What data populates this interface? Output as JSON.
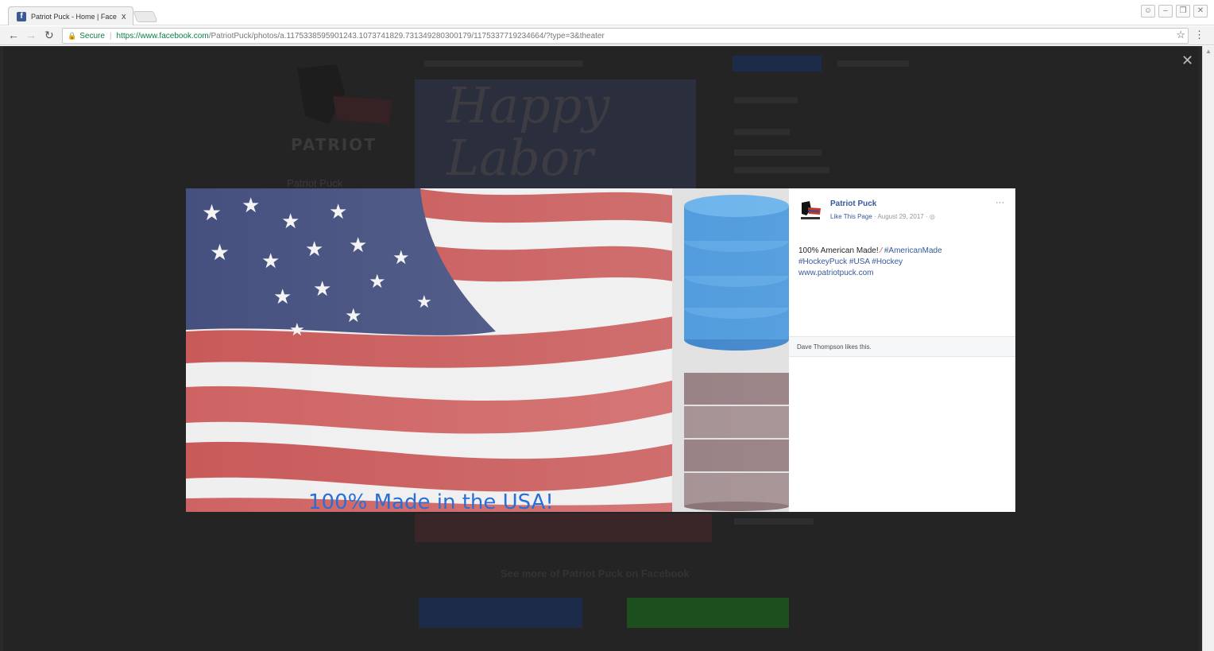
{
  "browser": {
    "tab_title": "Patriot Puck - Home | Face",
    "tab_close": "x",
    "secure_label": "Secure",
    "url_host": "https://www.facebook.com",
    "url_path": "/PatriotPuck/photos/a.1175338595901243.1073741829.731349280300179/1175337719234664/?type=3&theater"
  },
  "background_page": {
    "logo_text": "PATRIOT",
    "page_name": "Patriot Puck",
    "cover_text": "Happy Labor",
    "see_more": "See more of Patriot Puck on Facebook"
  },
  "photo": {
    "caption": "100% Made in the USA!",
    "colors": {
      "flag_red": "#c95a5a",
      "flag_white": "#f2f2f2",
      "flag_blue": "#3f4a7a",
      "puck_blue": "#3a8fd9",
      "caption_blue": "#2a6fd6"
    }
  },
  "post": {
    "page_name": "Patriot Puck",
    "like_page": "Like This Page",
    "date": " · August 29, 2017 · ",
    "privacy_icon": "globe-icon",
    "more": "···",
    "text_plain": "100% American Made! ",
    "hashtags_line1": " #AmericanMade",
    "hashtags_line2": "#HockeyPuck #USA #Hockey",
    "website": "www.patriotpuck.com",
    "likes_text": "Dave Thompson likes this."
  }
}
